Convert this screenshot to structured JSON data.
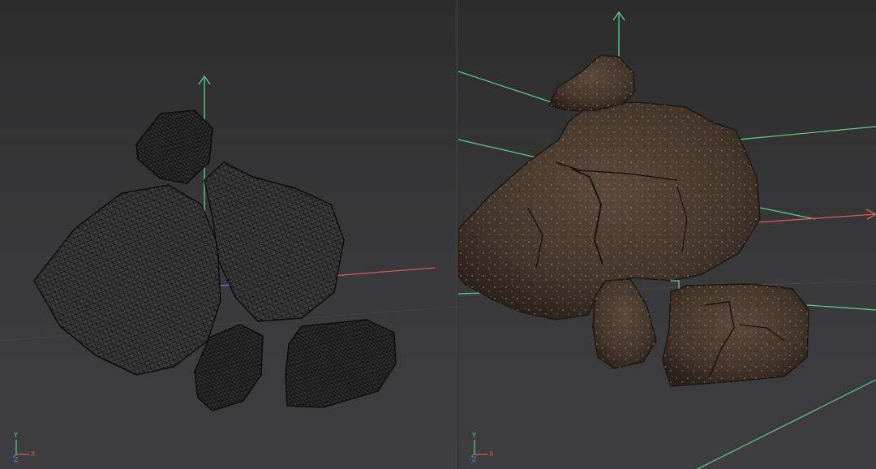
{
  "colors": {
    "background": "#3a3a3c",
    "axis_y": "#5fd08a",
    "axis_x": "#d85a5a",
    "axis_z": "#5a86d8",
    "wire_edge": "#0d0d0d",
    "wire_fill": "#3a3a3c",
    "rock_fill": "#4a3a30",
    "rock_dark": "#2b221c",
    "rock_light": "#6b5a4c"
  },
  "viewports": {
    "left": {
      "mode": "wireframe",
      "axis_labels": {
        "y": "Y",
        "x": "X",
        "z": "Z"
      }
    },
    "right": {
      "mode": "textured",
      "axis_labels": {
        "y": "Y",
        "x": "X",
        "z": "Z"
      }
    }
  }
}
